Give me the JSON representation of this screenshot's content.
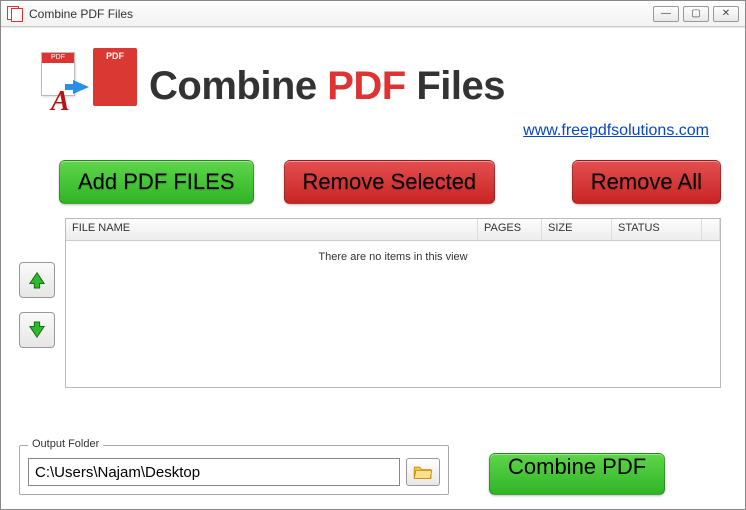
{
  "window": {
    "title": "Combine PDF Files"
  },
  "header": {
    "logo_pdf_label": "PDF",
    "title_p1": "Combine ",
    "title_accent": "PDF",
    "title_p2": " Files",
    "link_text": "www.freepdfsolutions.com"
  },
  "actions": {
    "add": "Add PDF FILES",
    "remove_selected": "Remove Selected",
    "remove_all": "Remove All"
  },
  "table": {
    "columns": {
      "file_name": "FILE NAME",
      "pages": "PAGES",
      "size": "SIZE",
      "status": "STATUS"
    },
    "empty_text": "There are no items in this view",
    "rows": []
  },
  "output": {
    "legend": "Output Folder",
    "path": "C:\\Users\\Najam\\Desktop"
  },
  "combine": {
    "label": "Combine PDF"
  }
}
